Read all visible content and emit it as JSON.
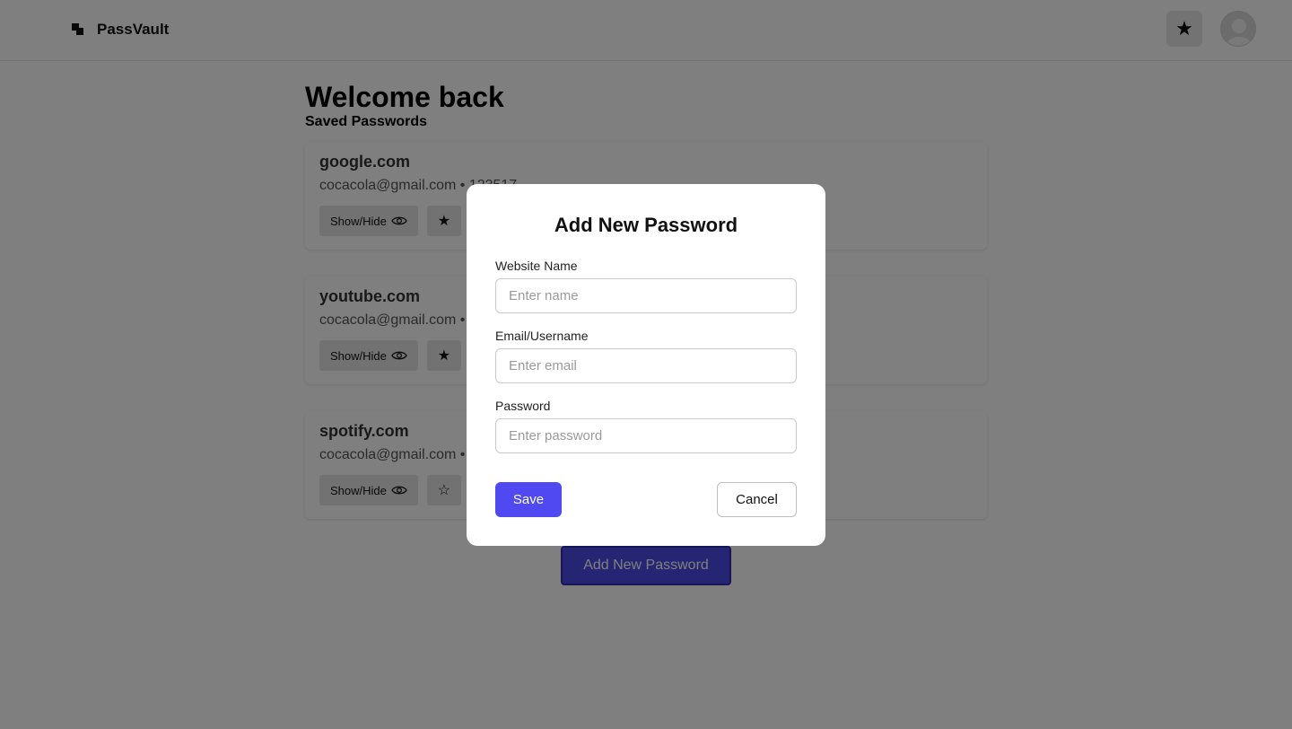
{
  "app": {
    "name": "PassVault",
    "logo_icon": "passvault-logo-icon",
    "favorites_icon": "star-filled-icon",
    "avatar_icon": "user-avatar-icon"
  },
  "main": {
    "title": "Welcome back",
    "subtitle": "Saved Passwords",
    "entries": [
      {
        "site": "google.com",
        "email": "cocacola@gmail.com",
        "separator": " • ",
        "password_masked": "123517",
        "show_hide_label": "Show/Hide",
        "show_hide_icon": "eye-icon",
        "favorite_glyph": "★",
        "favorited": true
      },
      {
        "site": "youtube.com",
        "email": "cocacola@gmail.com",
        "separator": " •",
        "show_hide_label": "Show/Hide",
        "show_hide_icon": "eye-icon",
        "favorite_glyph": "★",
        "favorited": true
      },
      {
        "site": "spotify.com",
        "email": "cocacola@gmail.com",
        "separator": " •",
        "show_hide_label": "Show/Hide",
        "show_hide_icon": "eye-icon",
        "favorite_glyph": "☆",
        "favorited": false
      }
    ],
    "add_button_label": "Add New Password"
  },
  "modal": {
    "title": "Add New Password",
    "fields": [
      {
        "label": "Website Name",
        "placeholder": "Enter name",
        "value": ""
      },
      {
        "label": "Email/Username",
        "placeholder": "Enter email",
        "value": ""
      },
      {
        "label": "Password",
        "placeholder": "Enter password",
        "value": ""
      }
    ],
    "save_label": "Save",
    "cancel_label": "Cancel"
  },
  "colors": {
    "primary": "#5048f0",
    "overlay": "rgba(0,0,0,0.5)",
    "background": "#ffffff"
  }
}
